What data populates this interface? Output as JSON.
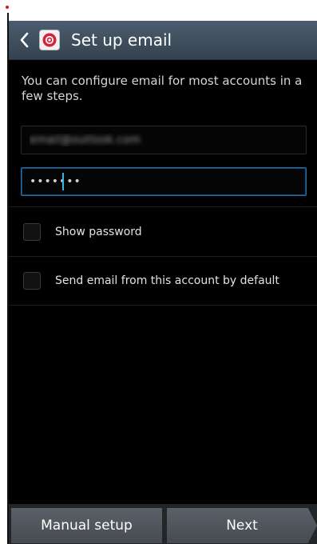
{
  "actionbar": {
    "title": "Set up email",
    "back_icon": "chevron-left-icon",
    "app_icon": "email-app-icon"
  },
  "intro": {
    "text": "You can configure email for most accounts in a few steps."
  },
  "form": {
    "email_value": "email@outlook.com",
    "password_value": "•••••••"
  },
  "options": [
    {
      "label": "Show password",
      "checked": false
    },
    {
      "label": "Send email from this account by default",
      "checked": false
    }
  ],
  "buttons": {
    "manual_label": "Manual setup",
    "next_label": "Next"
  },
  "colors": {
    "accent": "#33b5e5",
    "actionbar": "#415061",
    "background": "#000000"
  }
}
